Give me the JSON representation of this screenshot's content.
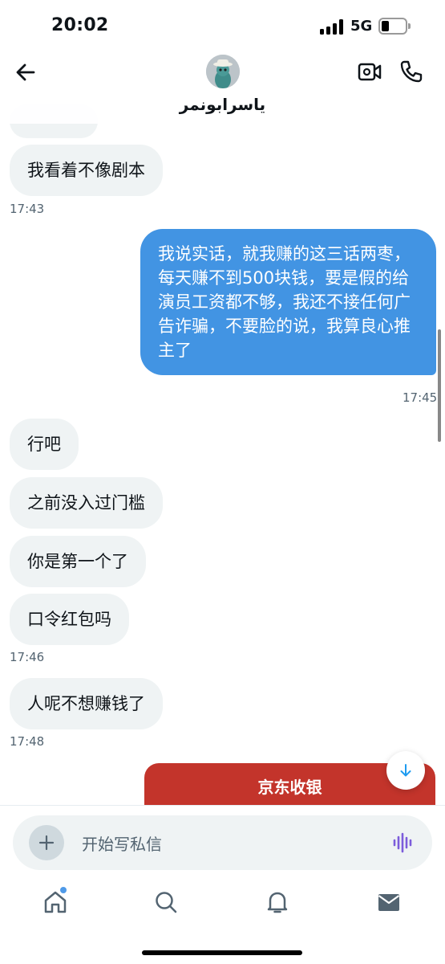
{
  "status_bar": {
    "time": "20:02",
    "network": "5G"
  },
  "header": {
    "contact_name": "ياسرابونمر"
  },
  "messages": {
    "in_1": "我看着不像剧本",
    "ts_1": "17:43",
    "out_1": "我说实话，就我赚的这三话两枣，每天赚不到500块钱，要是假的给演员工资都不够，我还不接任何广告诈骗，不要脸的说，我算良心推主了",
    "ts_2": "17:45",
    "in_2": "行吧",
    "in_3": "之前没入过门槛",
    "in_4": "你是第一个了",
    "in_5": "口令红包吗",
    "ts_3": "17:46",
    "in_6": "人呢不想赚钱了",
    "ts_4": "17:48"
  },
  "promo": {
    "label": "京东收银"
  },
  "composer": {
    "placeholder": "开始写私信"
  },
  "colors": {
    "outgoing_bubble": "#4294e3",
    "incoming_bubble": "#eff3f4",
    "promo": "#c3342b",
    "voice_icon": "#7c5cdb"
  },
  "icons": [
    "back-arrow-icon",
    "video-call-icon",
    "phone-icon",
    "plus-icon",
    "voice-icon",
    "arrow-down-icon",
    "home-icon",
    "search-icon",
    "bell-icon",
    "mail-icon"
  ]
}
